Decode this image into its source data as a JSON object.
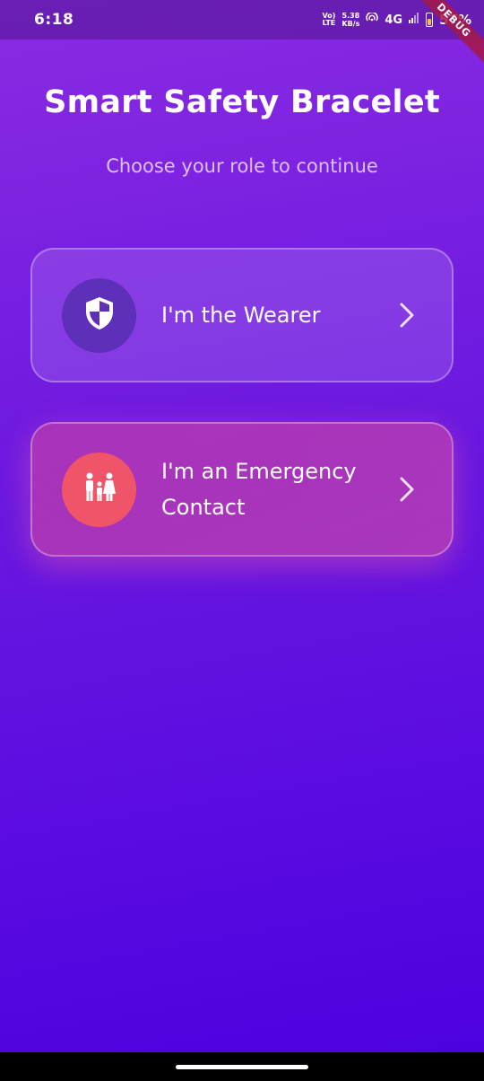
{
  "status_bar": {
    "time": "6:18",
    "volte_top": "Vo)",
    "volte_bottom": "LTE",
    "speed_value": "5.38",
    "speed_unit": "KB/s",
    "network": "4G",
    "battery_percent": "57%",
    "battery_level": 0.57,
    "battery_color": "#f5c518",
    "icons": [
      "hotspot-icon",
      "signal-icon",
      "battery-icon"
    ]
  },
  "debug_banner": "DEBUG",
  "header": {
    "title": "Smart Safety Bracelet",
    "subtitle": "Choose your role to continue"
  },
  "roles": {
    "wearer": {
      "label": "I'm the Wearer",
      "icon": "shield-icon",
      "icon_bg": "#5e2fb8"
    },
    "contact": {
      "label": "I'm an Emergency Contact",
      "icon": "family-icon",
      "icon_bg": "#ef5468"
    }
  },
  "colors": {
    "gradient_top": "#8a2be2",
    "gradient_bottom": "#4b00e0"
  }
}
